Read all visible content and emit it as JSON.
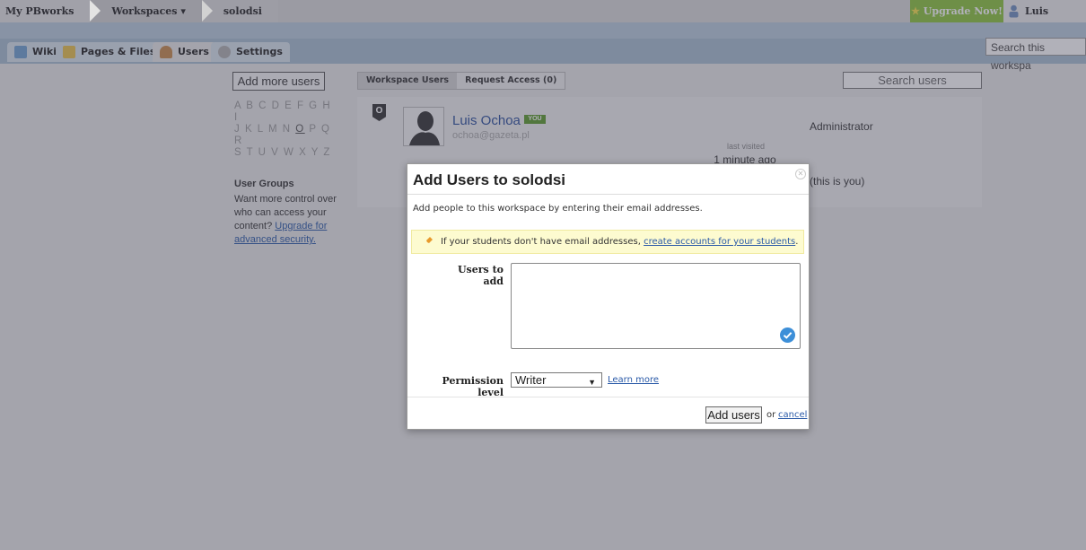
{
  "topbar": {
    "crumbs": [
      "My PBworks",
      "Workspaces ▾",
      "solodsi"
    ],
    "upgrade_label": "Upgrade Now!",
    "user_name": "Luis Ochoa"
  },
  "tabs": [
    {
      "label": "Wiki",
      "icon": "wiki-icon"
    },
    {
      "label": "Pages & Files",
      "icon": "folder-icon"
    },
    {
      "label": "Users",
      "icon": "users-icon"
    },
    {
      "label": "Settings",
      "icon": "gear-icon"
    }
  ],
  "workspace_search_placeholder": "Search this workspa",
  "left_panel": {
    "add_more_label": "Add more users",
    "alphabet_line1": "A B C D E F G H I",
    "alphabet_line2_pre": "J K L M N ",
    "alphabet_line2_sel": "O",
    "alphabet_line2_post": " P Q R",
    "alphabet_line3": "S T U V W X Y Z",
    "groups_title": "User Groups",
    "groups_text": "Want more control over who can access your content?",
    "groups_link": "Upgrade for advanced security."
  },
  "users_area": {
    "tabs": [
      "Workspace Users",
      "Request Access (0)"
    ],
    "search_placeholder": "Search users",
    "row": {
      "badge": "O",
      "name": "Luis Ochoa",
      "you_tag": "YOU",
      "email": "ochoa@gazeta.pl",
      "role": "Administrator",
      "last_visited_label": "last visited",
      "last_visited_time": "1 minute ago",
      "self_note": "(this is you)"
    }
  },
  "modal": {
    "title": "Add Users to solodsi",
    "intro": "Add people to this workspace by entering their email addresses.",
    "note_text": "If your students don't have email addresses,",
    "note_link": "create accounts for your students",
    "note_end": ".",
    "users_label": "Users to add",
    "users_value": "",
    "permission_label": "Permission level",
    "permission_value": "Writer",
    "learn_more": "Learn more",
    "add_button": "Add users",
    "or_text": "or",
    "cancel": "cancel"
  },
  "colors": {
    "upgrade_bg": "#8cc43c",
    "link": "#2a5aa8",
    "tabbar": "#a8bdd0",
    "note_bg": "#fdfbd0"
  }
}
